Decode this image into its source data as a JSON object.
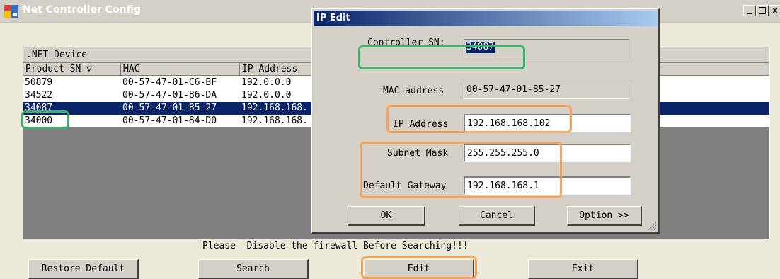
{
  "main": {
    "title": "Net Controller Config",
    "group_header": ".NET Device",
    "columns": [
      "Product SN ▽",
      "MAC",
      "IP Address"
    ],
    "rows": [
      {
        "sn": "50879",
        "mac": "00-57-47-01-C6-BF",
        "ip": "192.0.0.0"
      },
      {
        "sn": "34522",
        "mac": "00-57-47-01-86-DA",
        "ip": "192.0.0.0"
      },
      {
        "sn": "34087",
        "mac": "00-57-47-01-85-27",
        "ip": "192.168.168."
      },
      {
        "sn": "34000",
        "mac": "00-57-47-01-84-D0",
        "ip": "192.168.168."
      }
    ],
    "selected_row_index": 2,
    "firewall_message": "Please  Disable the firewall Before Searching!!!",
    "buttons": {
      "restore_default": "Restore Default",
      "search": "Search",
      "edit": "Edit",
      "exit": "Exit"
    },
    "window_controls": {
      "minimize": "_",
      "maximize": "□",
      "close": "X"
    }
  },
  "dialog": {
    "title": "IP Edit",
    "controller_sn_label": "Controller SN:",
    "controller_sn_value": "34087",
    "mac_label": "MAC address",
    "mac_value": "00-57-47-01-85-27",
    "ip_label": "IP Address",
    "ip_value": "192.168.168.102",
    "subnet_label": "Subnet Mask",
    "subnet_value": "255.255.255.0",
    "gateway_label": "Default Gateway",
    "gateway_value": "192.168.168.1",
    "ok_label": "OK",
    "cancel_label": "Cancel",
    "option_label": "Option >>"
  },
  "colors": {
    "selection": "#0a246a",
    "highlight_green": "#3ab26a",
    "highlight_orange": "#f5a35c"
  },
  "icons": [
    "app-icon",
    "sort-down-icon",
    "size-grip-icon"
  ]
}
